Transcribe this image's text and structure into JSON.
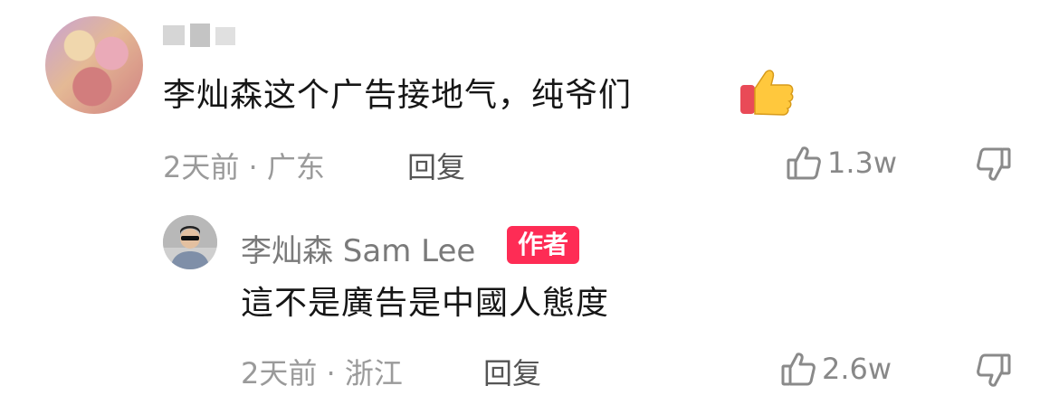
{
  "comment": {
    "text": "李灿森这个广告接地气，纯爷们",
    "emoji": "thumbs-up",
    "time": "2天前",
    "location": "广东",
    "reply_label": "回复",
    "likes": "1.3w"
  },
  "reply": {
    "author": "李灿森 Sam Lee",
    "badge": "作者",
    "text": "這不是廣告是中國人態度",
    "time": "2天前",
    "location": "浙江",
    "reply_label": "回复",
    "likes": "2.6w"
  },
  "icons": {
    "like": "thumbs-up-icon",
    "dislike": "thumbs-down-icon"
  },
  "colors": {
    "badge": "#fe2c55",
    "meta": "#9a9a9a",
    "text": "#161616"
  }
}
